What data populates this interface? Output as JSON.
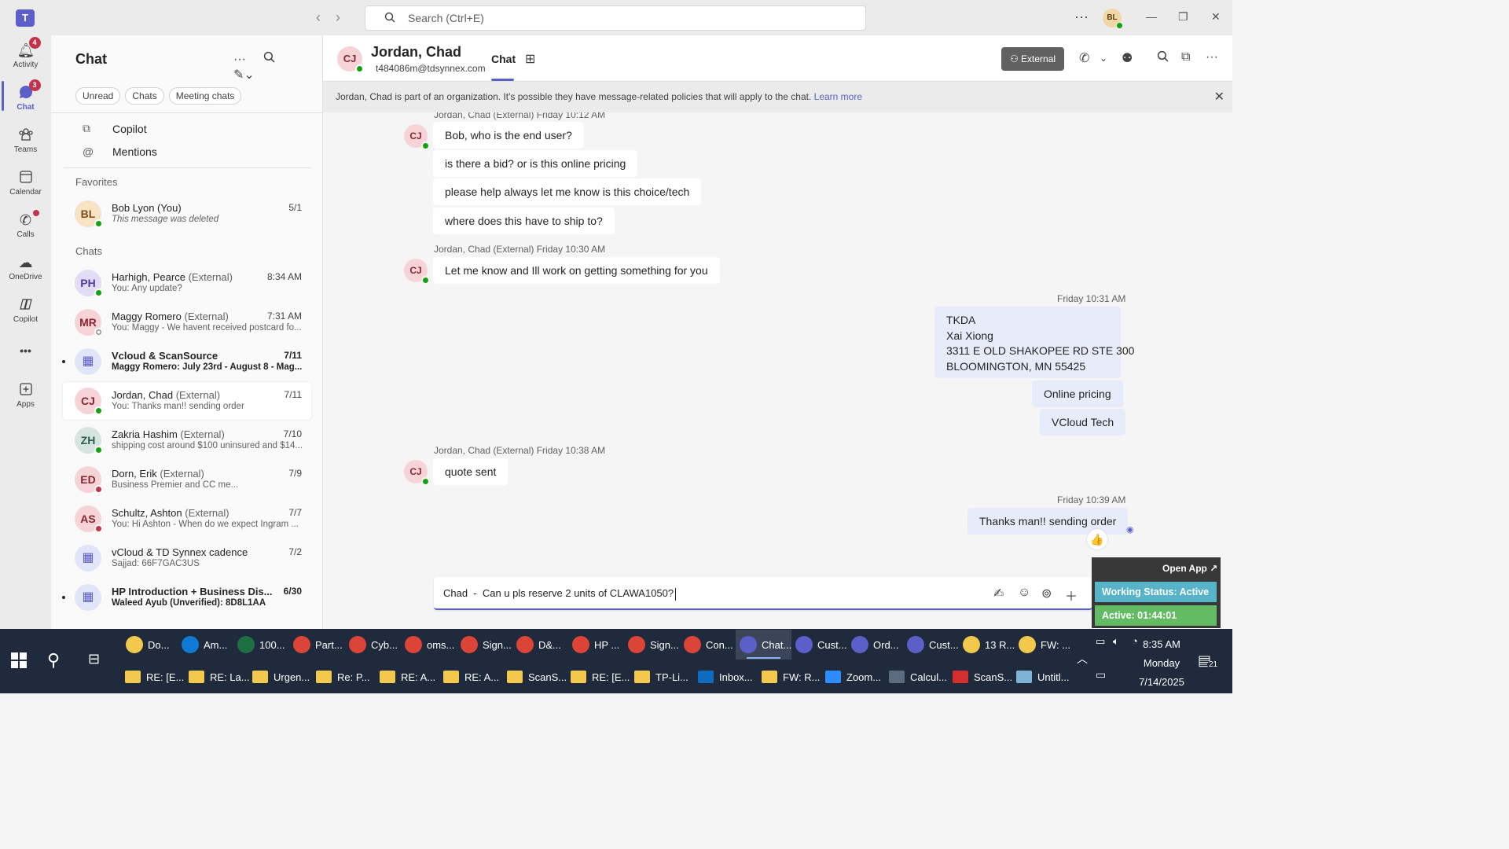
{
  "titlebar": {
    "search_placeholder": "Search (Ctrl+E)",
    "user_initials": "BL",
    "back": "‹",
    "forward": "›",
    "more": "···"
  },
  "rail": {
    "items": [
      {
        "label": "Activity",
        "badge": "4"
      },
      {
        "label": "Chat",
        "badge": "3"
      },
      {
        "label": "Teams"
      },
      {
        "label": "Calendar"
      },
      {
        "label": "Calls"
      },
      {
        "label": "OneDrive"
      },
      {
        "label": "Copilot"
      },
      {
        "label": "Apps"
      }
    ],
    "more": "•••"
  },
  "chatlist": {
    "title": "Chat",
    "filters": [
      "Unread",
      "Chats",
      "Meeting chats"
    ],
    "copilot": "Copilot",
    "mentions": "Mentions",
    "favorites_header": "Favorites",
    "chats_header": "Chats",
    "favorites": [
      {
        "initials": "BL",
        "name": "Bob Lyon (You)",
        "ext": "",
        "preview": "This message was deleted",
        "date": "5/1"
      }
    ],
    "chats": [
      {
        "initials": "PH",
        "name": "Harhigh, Pearce",
        "ext": "(External)",
        "preview": "You: Any update?",
        "date": "8:34 AM"
      },
      {
        "initials": "MR",
        "name": "Maggy Romero",
        "ext": "(External)",
        "preview": "You: Maggy - We havent received postcard fo...",
        "date": "7:31 AM"
      },
      {
        "initials": "",
        "name": "Vcloud & ScanSource",
        "ext": "",
        "preview": "Maggy Romero: July 23rd - August 8 - Mag...",
        "date": "7/11"
      },
      {
        "initials": "CJ",
        "name": "Jordan, Chad",
        "ext": "(External)",
        "preview": "You: Thanks man!! sending order",
        "date": "7/11"
      },
      {
        "initials": "ZH",
        "name": "Zakria Hashim",
        "ext": "(External)",
        "preview": "shipping cost around $100 uninsured and $14...",
        "date": "7/10"
      },
      {
        "initials": "ED",
        "name": "Dorn, Erik",
        "ext": "(External)",
        "preview": "Business Premier and CC me...",
        "date": "7/9"
      },
      {
        "initials": "AS",
        "name": "Schultz, Ashton",
        "ext": "(External)",
        "preview": "You: Hi Ashton -  When do we expect Ingram ...",
        "date": "7/7"
      },
      {
        "initials": "",
        "name": "vCloud & TD Synnex cadence",
        "ext": "",
        "preview": "Sajjad: 66F7GAC3US",
        "date": "7/2"
      },
      {
        "initials": "",
        "name": "HP Introduction + Business Dis...",
        "ext": "",
        "preview": "Waleed Ayub (Unverified): 8D8L1AA",
        "date": "6/30"
      }
    ]
  },
  "conversation": {
    "initials": "CJ",
    "name": "Jordan, Chad",
    "email": "t484086m@tdsynnex.com",
    "tab": "Chat",
    "external_label": "External",
    "banner_text": "Jordan, Chad is part of an organization. It's possible they have message-related policies that will apply to the chat. ",
    "banner_link": "Learn more",
    "groups": [
      {
        "meta": "Jordan, Chad (External)   Friday 10:12 AM",
        "messages": [
          "Bob, who is the end user?",
          "is there a bid? or is this online pricing",
          "please help always let me know is this choice/tech",
          "where does this have to ship to?"
        ]
      },
      {
        "meta": "Jordan, Chad (External)   Friday 10:30 AM",
        "messages": [
          "Let me know and Ill work on getting something for you"
        ]
      },
      {
        "meta": "Jordan, Chad (External)   Friday 10:38 AM",
        "messages": [
          "quote sent"
        ]
      }
    ],
    "out1": {
      "meta": "Friday 10:31 AM",
      "address": [
        "TKDA",
        "Xai Xiong",
        "3311 E OLD SHAKOPEE RD STE 300",
        "BLOOMINGTON, MN 55425"
      ],
      "msg2": "Online pricing",
      "msg3": "VCloud Tech"
    },
    "out2": {
      "meta": "Friday 10:39 AM",
      "msg": "Thanks man!! sending order",
      "reaction": "👍"
    },
    "composer_text": "Chad  -  Can u pls reserve 2 units of CLAWA1050?"
  },
  "widget": {
    "open_app": "Open App ↗",
    "status": "Working Status: Active",
    "active": "Active: 01:44:01"
  },
  "taskbar": {
    "row1": [
      {
        "label": "Do...",
        "color": "#f2c94c"
      },
      {
        "label": "Am...",
        "color": "#0f7bd6"
      },
      {
        "label": "100...",
        "color": "#1d7044"
      },
      {
        "label": "Part...",
        "color": "#db4437"
      },
      {
        "label": "Cyb...",
        "color": "#db4437"
      },
      {
        "label": "oms...",
        "color": "#db4437"
      },
      {
        "label": "Sign...",
        "color": "#db4437"
      },
      {
        "label": "D&...",
        "color": "#db4437"
      },
      {
        "label": "HP ...",
        "color": "#db4437"
      },
      {
        "label": "Sign...",
        "color": "#db4437"
      },
      {
        "label": "Con...",
        "color": "#db4437"
      },
      {
        "label": "Chat...",
        "color": "#5b5fc7"
      },
      {
        "label": "Cust...",
        "color": "#5b5fc7"
      },
      {
        "label": "Ord...",
        "color": "#5b5fc7"
      },
      {
        "label": "Cust...",
        "color": "#5b5fc7"
      },
      {
        "label": "13 R...",
        "color": "#f2c94c"
      },
      {
        "label": "FW: ...",
        "color": "#f2c94c"
      }
    ],
    "row2": [
      {
        "label": "RE: [E...",
        "color": "#f2c94c"
      },
      {
        "label": "RE: La...",
        "color": "#f2c94c"
      },
      {
        "label": "Urgen...",
        "color": "#f2c94c"
      },
      {
        "label": "Re: P...",
        "color": "#f2c94c"
      },
      {
        "label": "RE: A...",
        "color": "#f2c94c"
      },
      {
        "label": "RE: A...",
        "color": "#f2c94c"
      },
      {
        "label": "ScanS...",
        "color": "#f2c94c"
      },
      {
        "label": "RE: [E...",
        "color": "#f2c94c"
      },
      {
        "label": "TP-Li...",
        "color": "#f2c94c"
      },
      {
        "label": "Inbox...",
        "color": "#0f6cbd"
      },
      {
        "label": "FW: R...",
        "color": "#f2c94c"
      },
      {
        "label": "Zoom...",
        "color": "#2d8cff"
      },
      {
        "label": "Calcul...",
        "color": "#5b6b80"
      },
      {
        "label": "ScanS...",
        "color": "#d32f2f"
      },
      {
        "label": "Untitl...",
        "color": "#7fb3d5"
      }
    ],
    "time": "8:35 AM",
    "day": "Monday",
    "date": "7/14/2025",
    "notif_count": "21"
  }
}
